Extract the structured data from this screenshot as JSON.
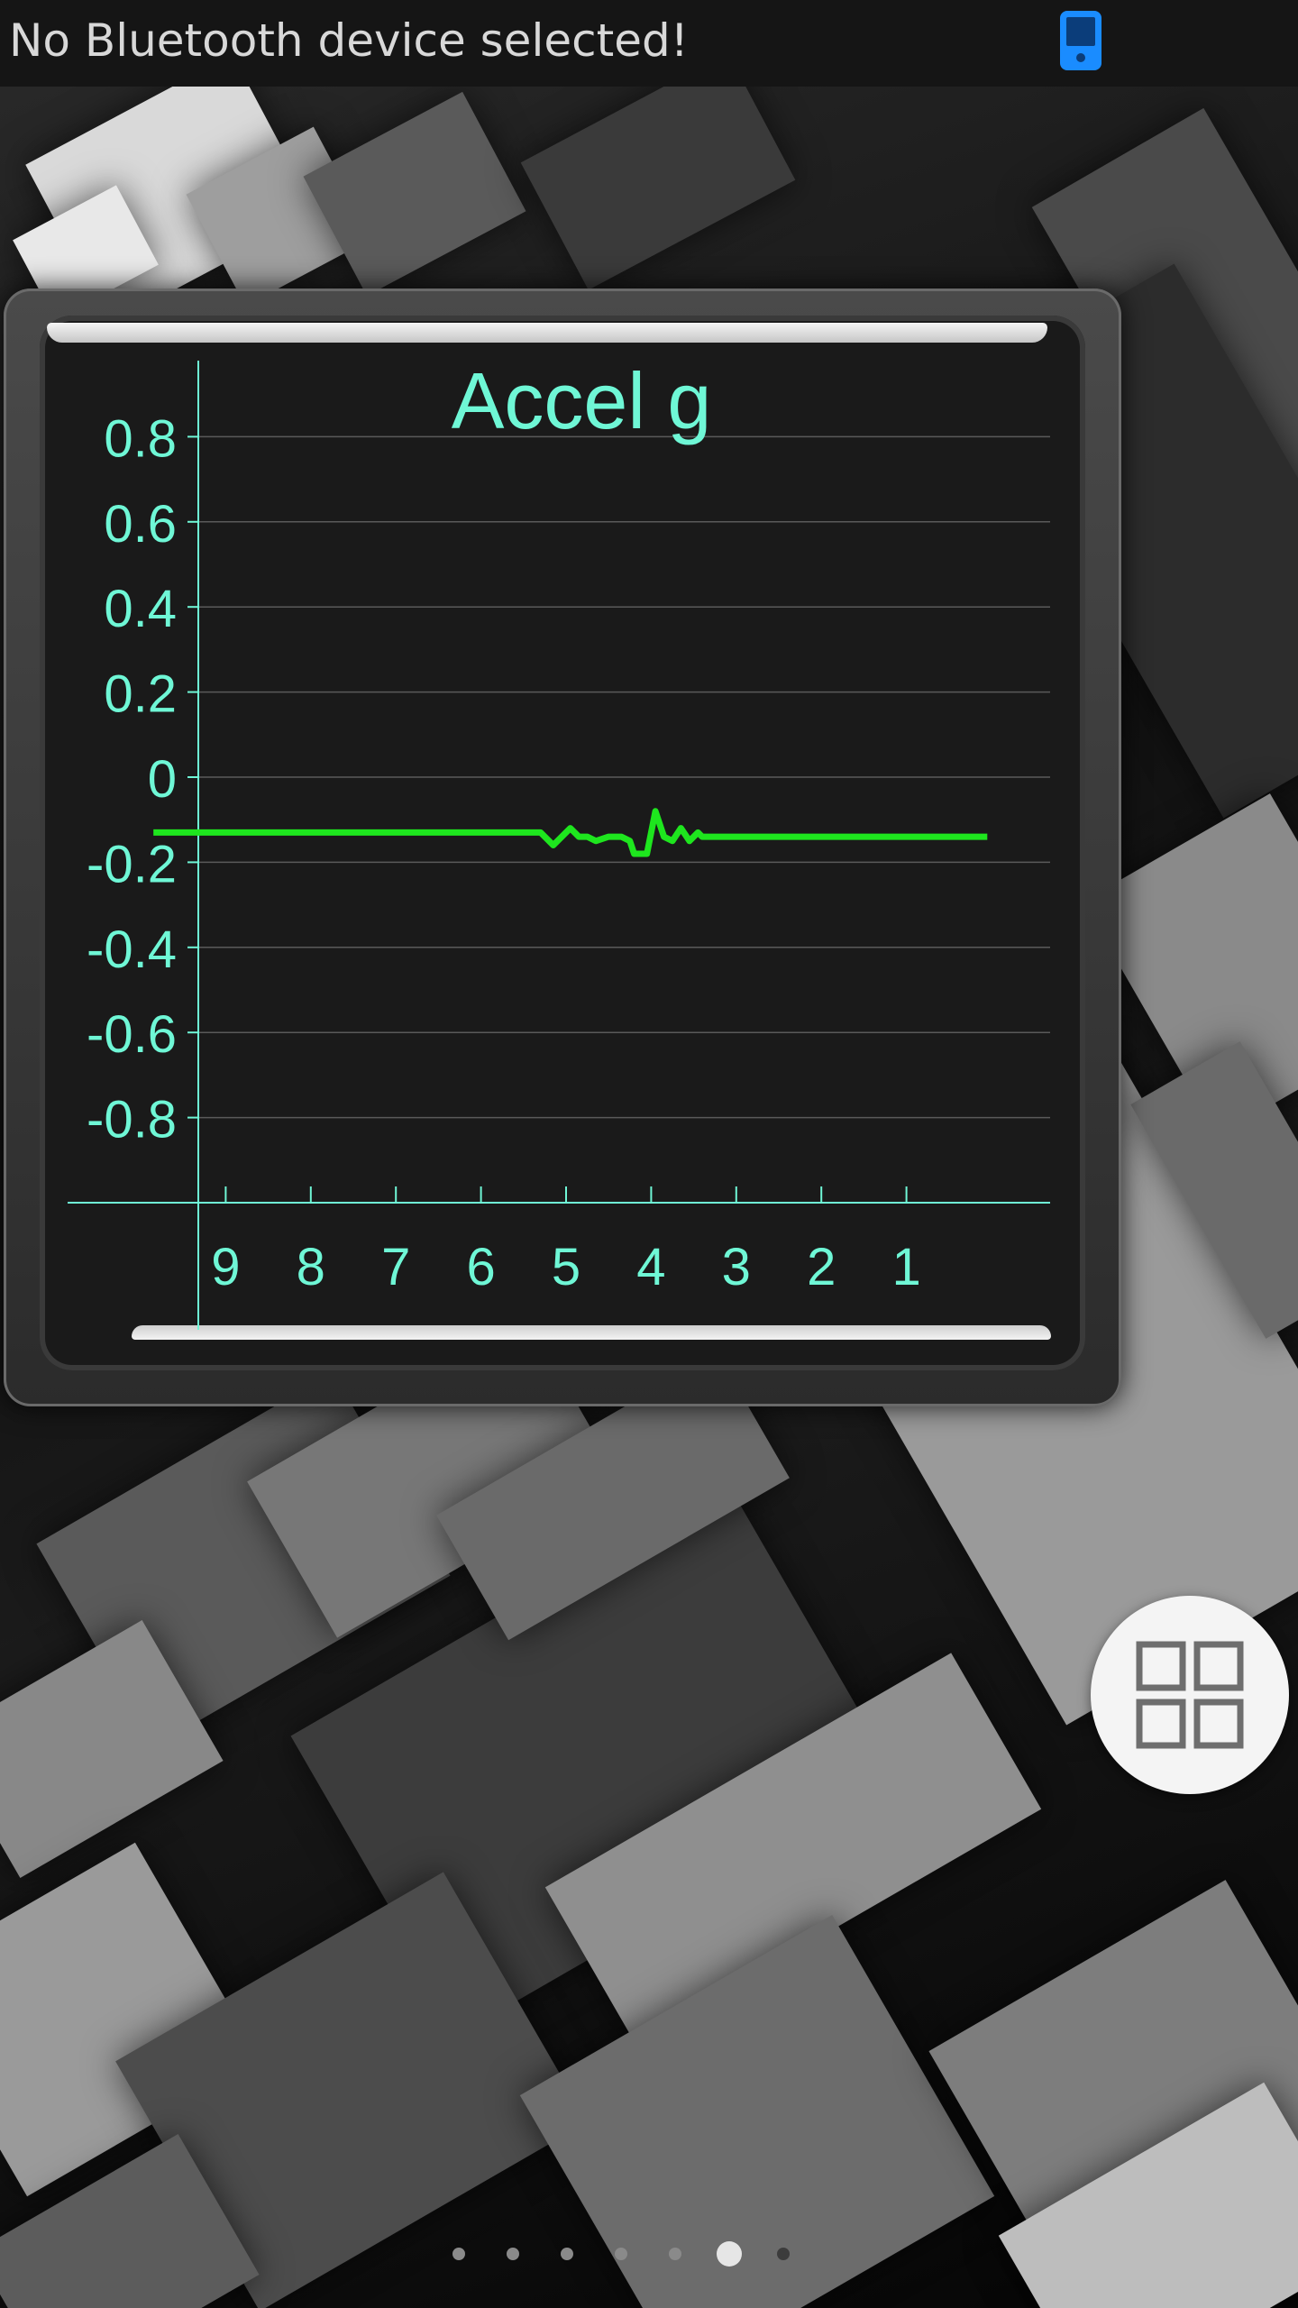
{
  "status_bar": {
    "message": "No Bluetooth device selected!",
    "device_icon": "bluetooth-device-icon",
    "icon_color": "#1a8cff"
  },
  "gauge": {
    "frame_color": "#3a3a3a",
    "text_color": "#6ff7d6",
    "line_color": "#1ee61e"
  },
  "chart_data": {
    "type": "line",
    "title": "Accel g",
    "xlabel": "",
    "ylabel": "",
    "ylim": [
      -1,
      1
    ],
    "xlim": [
      10,
      0
    ],
    "yticks": [
      "0.8",
      "0.6",
      "0.4",
      "0.2",
      "0",
      "-0.2",
      "-0.4",
      "-0.6",
      "-0.8"
    ],
    "ytick_values": [
      0.8,
      0.6,
      0.4,
      0.2,
      0,
      -0.2,
      -0.4,
      -0.6,
      -0.8
    ],
    "xticks": [
      "9",
      "8",
      "7",
      "6",
      "5",
      "4",
      "3",
      "2",
      "1"
    ],
    "xtick_values": [
      9,
      8,
      7,
      6,
      5,
      4,
      3,
      2,
      1
    ],
    "grid": true,
    "series": [
      {
        "x": [
          9.85,
          8,
          6,
          5.3,
          5.15,
          4.95,
          4.85,
          4.75,
          4.65,
          4.5,
          4.35,
          4.25,
          4.2,
          4.05,
          3.95,
          3.85,
          3.75,
          3.65,
          3.55,
          3.45,
          3.4,
          3.3,
          3.2,
          3.1,
          2.8,
          2,
          1,
          0.05
        ],
        "y": [
          -0.13,
          -0.13,
          -0.13,
          -0.13,
          -0.16,
          -0.12,
          -0.14,
          -0.14,
          -0.15,
          -0.14,
          -0.14,
          -0.15,
          -0.18,
          -0.18,
          -0.08,
          -0.14,
          -0.15,
          -0.12,
          -0.15,
          -0.13,
          -0.14,
          -0.14,
          -0.14,
          -0.14,
          -0.14,
          -0.14,
          -0.14,
          -0.14
        ]
      }
    ]
  },
  "fab": {
    "icon": "grid-view-icon"
  },
  "pager": {
    "count": 7,
    "active_index": 5,
    "faint_index": 6
  }
}
